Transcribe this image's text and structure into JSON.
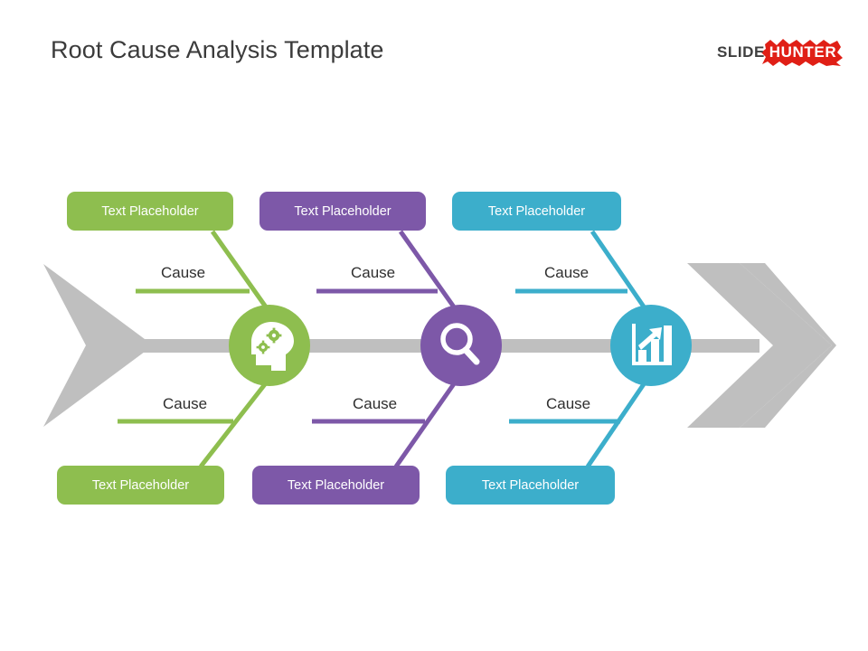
{
  "page": {
    "title": "Root Cause Analysis Template",
    "background": "#ffffff"
  },
  "logo": {
    "name": "slidehunter-logo",
    "word_one": "SLIDE",
    "word_two": "HUNTER",
    "word_one_color": "#3f3f3f",
    "badge_color": "#e01f16",
    "word_two_color": "#ffffff"
  },
  "colors": {
    "green": "#8EBE4F",
    "purple": "#7D58A8",
    "blue": "#3CAECB",
    "spine_gray": "#BFBFBF",
    "text_dark": "#2f2f2f",
    "white": "#ffffff"
  },
  "diagram": {
    "type": "fishbone-ishikawa",
    "spine_label": "backbone-arrow",
    "branches": [
      {
        "id": "green",
        "color": "#8EBE4F",
        "icon": "head-gears-icon",
        "top_placeholder": "Text Placeholder",
        "top_cause": "Cause",
        "bottom_placeholder": "Text Placeholder",
        "bottom_cause": "Cause"
      },
      {
        "id": "purple",
        "color": "#7D58A8",
        "icon": "magnifier-icon",
        "top_placeholder": "Text Placeholder",
        "top_cause": "Cause",
        "bottom_placeholder": "Text Placeholder",
        "bottom_cause": "Cause"
      },
      {
        "id": "blue",
        "color": "#3CAECB",
        "icon": "bar-chart-growth-icon",
        "top_placeholder": "Text Placeholder",
        "top_cause": "Cause",
        "bottom_placeholder": "Text Placeholder",
        "bottom_cause": "Cause"
      }
    ]
  }
}
